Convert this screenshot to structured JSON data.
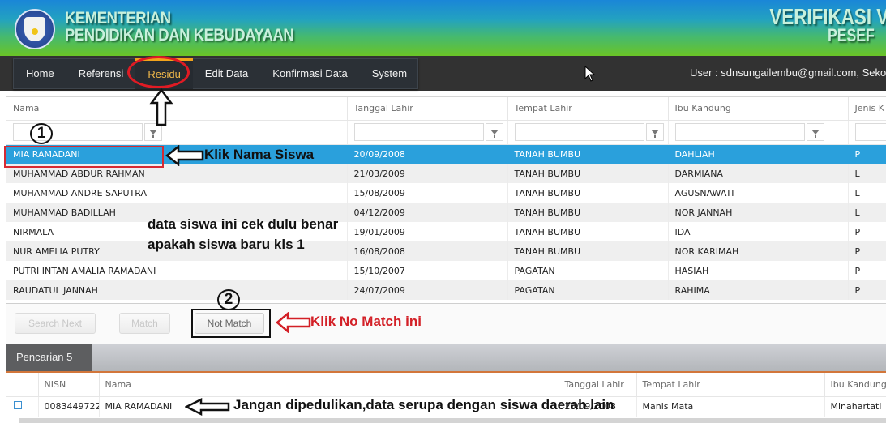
{
  "header": {
    "ministry_line1": "KEMENTERIAN",
    "ministry_line2": "PENDIDIKAN DAN KEBUDAYAAN",
    "app_title_line1": "VERIFIKASI VA",
    "app_title_line2": "PESEF",
    "logo_icon": "tut-wuri-handayani-logo"
  },
  "nav": {
    "items": [
      {
        "label": "Home",
        "active": false
      },
      {
        "label": "Referensi",
        "active": false
      },
      {
        "label": "Residu",
        "active": true
      },
      {
        "label": "Edit Data",
        "active": false
      },
      {
        "label": "Konfirmasi Data",
        "active": false
      },
      {
        "label": "System",
        "active": false
      }
    ],
    "user_info": "User : sdnsungailembu@gmail.com, Sekola"
  },
  "grid": {
    "columns": [
      "Nama",
      "Tanggal Lahir",
      "Tempat Lahir",
      "Ibu Kandung",
      "Jenis K"
    ],
    "filter_values": [
      "",
      "",
      "",
      "",
      ""
    ],
    "rows": [
      {
        "nama": "MIA RAMADANI",
        "tanggal_lahir": "20/09/2008",
        "tempat_lahir": "TANAH BUMBU",
        "ibu_kandung": "DAHLIAH",
        "jenis_kelamin": "P",
        "selected": true
      },
      {
        "nama": "MUHAMMAD ABDUR RAHMAN",
        "tanggal_lahir": "21/03/2009",
        "tempat_lahir": "TANAH BUMBU",
        "ibu_kandung": "DARMIANA",
        "jenis_kelamin": "L"
      },
      {
        "nama": "MUHAMMAD ANDRE SAPUTRA",
        "tanggal_lahir": "15/08/2009",
        "tempat_lahir": "TANAH BUMBU",
        "ibu_kandung": "AGUSNAWATI",
        "jenis_kelamin": "L"
      },
      {
        "nama": "MUHAMMAD BADILLAH",
        "tanggal_lahir": "04/12/2009",
        "tempat_lahir": "TANAH BUMBU",
        "ibu_kandung": "NOR JANNAH",
        "jenis_kelamin": "L"
      },
      {
        "nama": "NIRMALA",
        "tanggal_lahir": "19/01/2009",
        "tempat_lahir": "TANAH BUMBU",
        "ibu_kandung": "IDA",
        "jenis_kelamin": "P"
      },
      {
        "nama": "NUR AMELIA PUTRY",
        "tanggal_lahir": "16/08/2008",
        "tempat_lahir": "TANAH BUMBU",
        "ibu_kandung": "NOR KARIMAH",
        "jenis_kelamin": "P"
      },
      {
        "nama": "PUTRI INTAN AMALIA RAMADANI",
        "tanggal_lahir": "15/10/2007",
        "tempat_lahir": "PAGATAN",
        "ibu_kandung": "HASIAH",
        "jenis_kelamin": "P"
      },
      {
        "nama": "RAUDATUL JANNAH",
        "tanggal_lahir": "24/07/2009",
        "tempat_lahir": "PAGATAN",
        "ibu_kandung": "RAHIMA",
        "jenis_kelamin": "P"
      }
    ]
  },
  "buttons": {
    "search_next": "Search Next",
    "match": "Match",
    "not_match": "Not Match"
  },
  "result_tab": {
    "label": "Pencarian 5"
  },
  "result_grid": {
    "columns": [
      "",
      "NISN",
      "Nama",
      "Tanggal Lahir",
      "Tempat Lahir",
      "Ibu Kandung"
    ],
    "rows": [
      {
        "checked": false,
        "nisn": "0083449722",
        "nama": "MIA RAMADANI",
        "tanggal_lahir": "20/09/2008",
        "tempat_lahir": "Manis Mata",
        "ibu_kandung": "Minahartati"
      }
    ]
  },
  "annotations": {
    "step1_number": "1",
    "step2_number": "2",
    "click_student_name": "Klik Nama Siswa",
    "check_data_line1": "data siswa ini cek dulu benar",
    "check_data_line2": "apakah siswa baru kls 1",
    "click_not_match": "Klik No Match ini",
    "ignore_note": "Jangan dipedulikan,data serupa dengan siswa daerah lain"
  },
  "colors": {
    "selected_row": "#2aa0dc",
    "active_menu": "#f0b84a",
    "annotation_red": "#d32027",
    "tab_accent": "#d2763a"
  }
}
